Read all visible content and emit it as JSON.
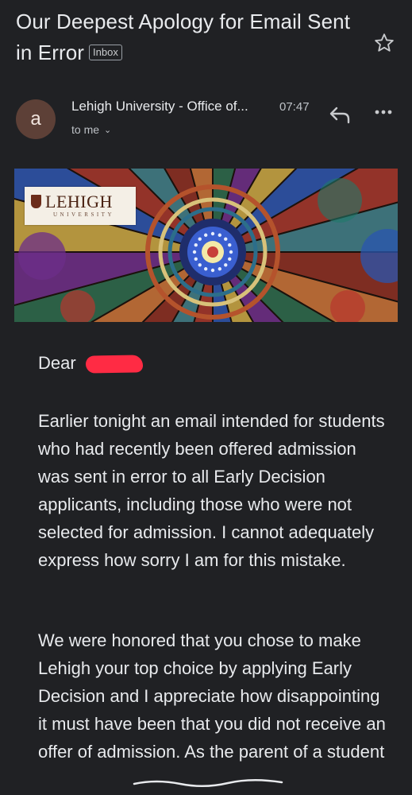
{
  "email": {
    "subject": "Our Deepest Apology for Email Sent in Error",
    "label": "Inbox",
    "sender": {
      "avatar_letter": "a",
      "name": "Lehigh University - Office of...",
      "time": "07:47",
      "recipient": "to me"
    },
    "icons": {
      "star": "star-icon",
      "reply": "reply-icon",
      "more": "more-vert-icon",
      "expand": "chevron-down-icon"
    },
    "banner": {
      "logo_text": "LEHIGH",
      "logo_subtext": "UNIVERSITY"
    },
    "body": {
      "greeting": "Dear",
      "paragraphs": [
        "Earlier tonight an email intended for students who had recently been offered admission was sent in error to all Early Decision applicants, including those who were not selected for admission. I cannot adequately express how sorry I am for this mistake.",
        "We were honored that you chose to make Lehigh your top choice by applying Early Decision and I appreciate how disappointing it must have been that you did not receive an offer of admission. As the parent of a student"
      ]
    }
  },
  "colors": {
    "background": "#202124",
    "text": "#e8eaed",
    "avatar": "#5d4037",
    "redaction": "#ff2b44"
  }
}
